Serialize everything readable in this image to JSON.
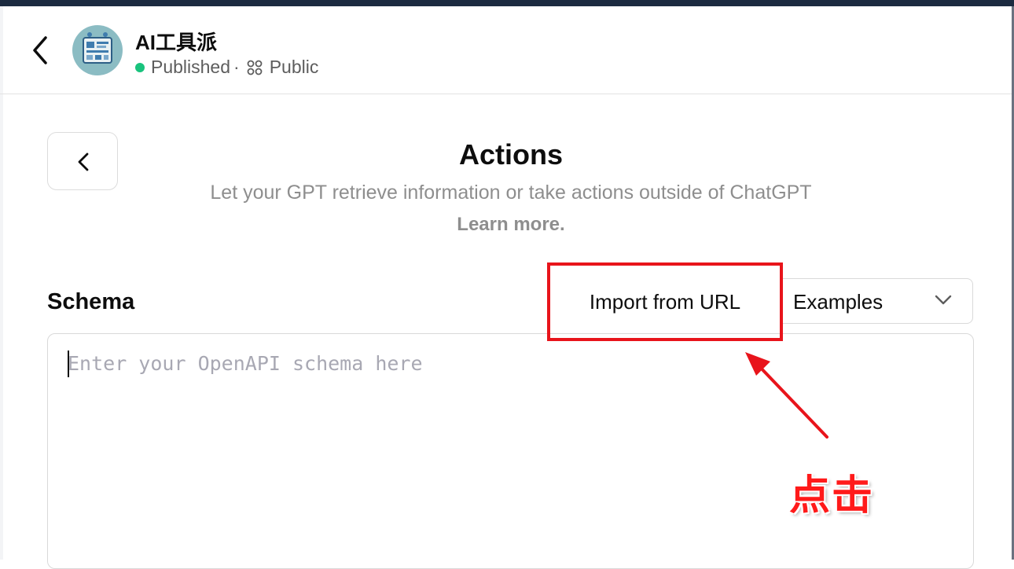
{
  "header": {
    "gpt_name": "AI工具派",
    "status": "Published",
    "separator": "·",
    "visibility": "Public"
  },
  "actions": {
    "title": "Actions",
    "subtitle": "Let your GPT retrieve information or take actions outside of ChatGPT",
    "learn_more": "Learn more."
  },
  "schema": {
    "label": "Schema",
    "import_button": "Import from URL",
    "examples_label": "Examples",
    "placeholder": "Enter your OpenAPI schema here",
    "value": ""
  },
  "annotation": {
    "label": "点击",
    "color": "#e8141b"
  },
  "colors": {
    "published_dot": "#19c37d",
    "top_strip": "#1c2b40"
  }
}
